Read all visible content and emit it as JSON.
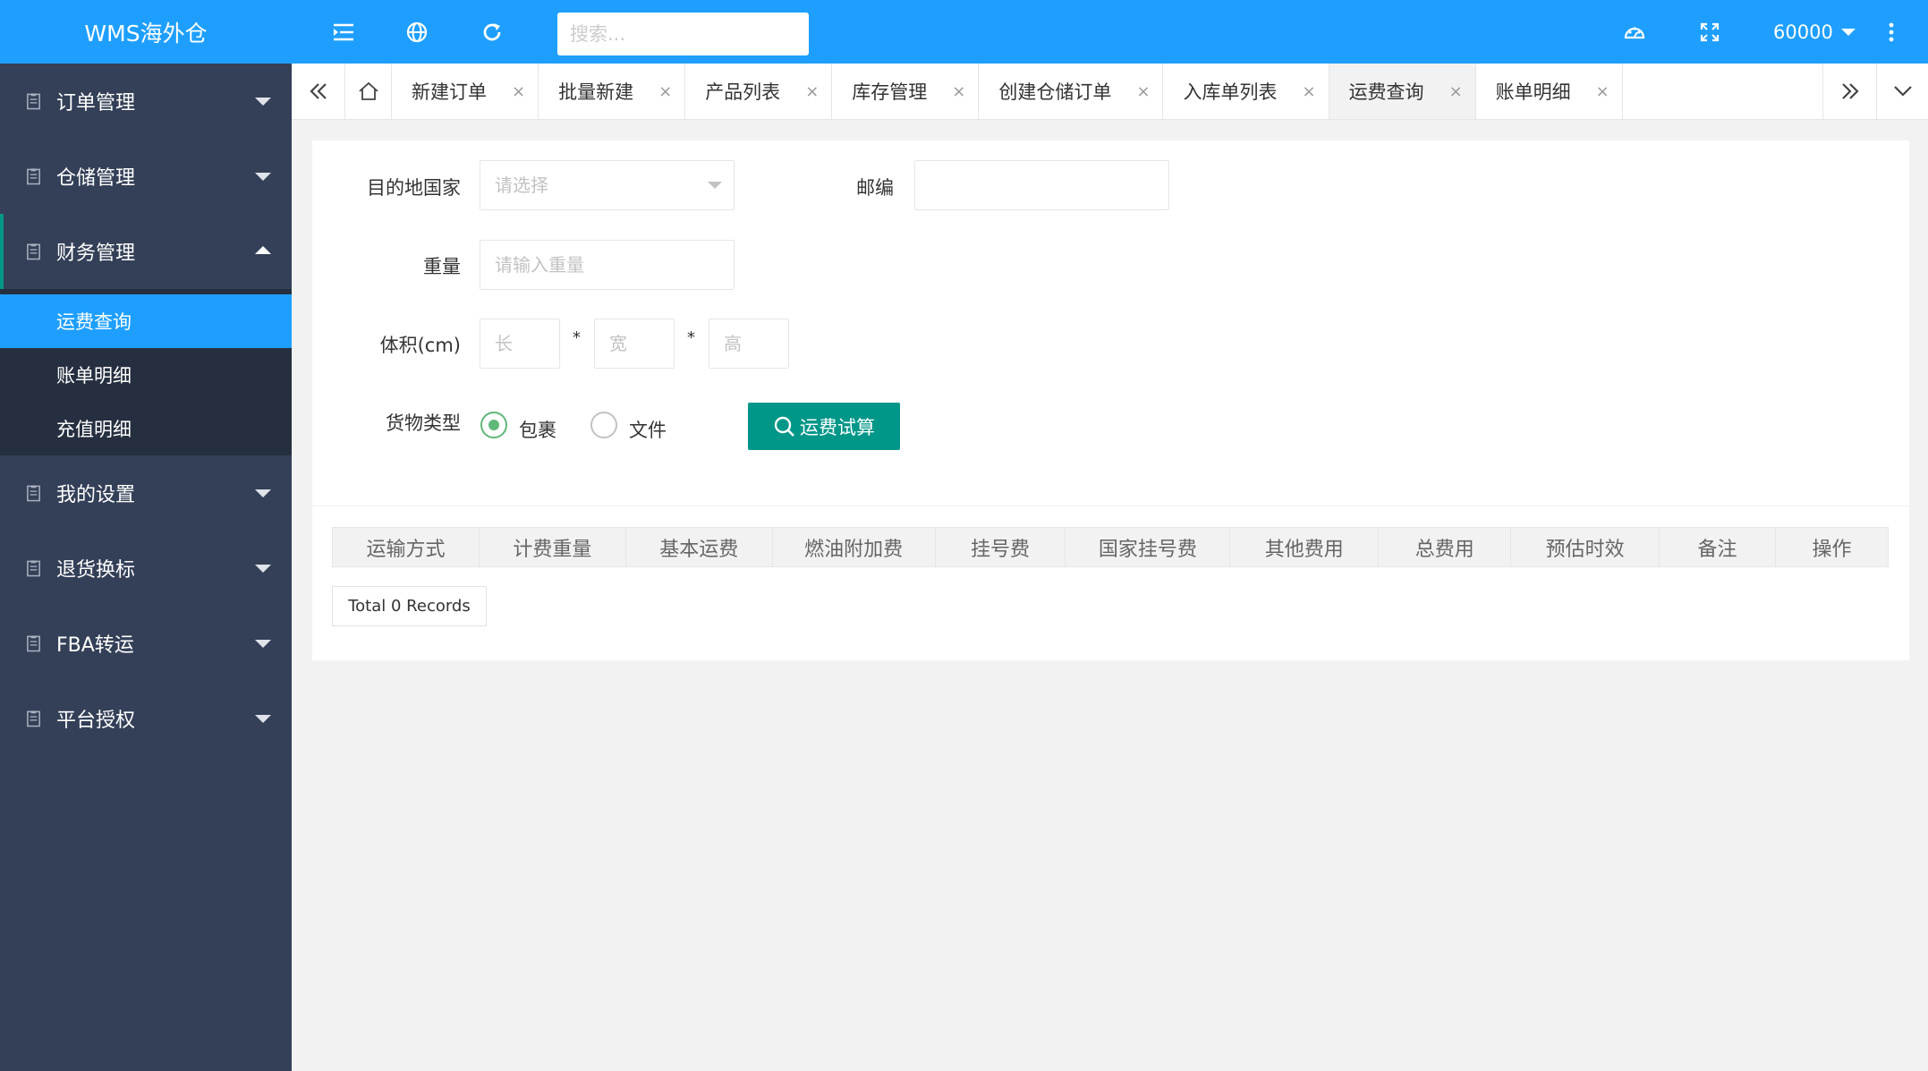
{
  "app": {
    "title": "WMS海外仓"
  },
  "header": {
    "search_placeholder": "搜索...",
    "user": "60000",
    "icons": [
      "menu-fold-icon",
      "globe-icon",
      "refresh-icon",
      "theme-palette-icon",
      "fullscreen-icon",
      "more-vertical-icon"
    ]
  },
  "sidebar": {
    "items": [
      {
        "label": "订单管理"
      },
      {
        "label": "仓储管理"
      },
      {
        "label": "财务管理",
        "expanded": true,
        "children": [
          {
            "label": "运费查询",
            "active": true
          },
          {
            "label": "账单明细"
          },
          {
            "label": "充值明细"
          }
        ]
      },
      {
        "label": "我的设置"
      },
      {
        "label": "退货换标"
      },
      {
        "label": "FBA转运"
      },
      {
        "label": "平台授权"
      }
    ]
  },
  "tabs": [
    {
      "label": "新建订单"
    },
    {
      "label": "批量新建"
    },
    {
      "label": "产品列表"
    },
    {
      "label": "库存管理"
    },
    {
      "label": "创建仓储订单"
    },
    {
      "label": "入库单列表"
    },
    {
      "label": "运费查询",
      "active": true
    },
    {
      "label": "账单明细"
    }
  ],
  "tab_close": "×",
  "form": {
    "country_label": "目的地国家",
    "country_placeholder": "请选择",
    "zip_label": "邮编",
    "zip_value": "",
    "weight_label": "重量",
    "weight_placeholder": "请输入重量",
    "volume_label": "体积(cm)",
    "length_placeholder": "长",
    "width_placeholder": "宽",
    "height_placeholder": "高",
    "multiply": "*",
    "cargo_label": "货物类型",
    "cargo_options": [
      {
        "label": "包裹",
        "checked": true
      },
      {
        "label": "文件",
        "checked": false
      }
    ],
    "calc_button": "运费试算"
  },
  "table": {
    "columns": [
      "运输方式",
      "计费重量",
      "基本运费",
      "燃油附加费",
      "挂号费",
      "国家挂号费",
      "其他费用",
      "总费用",
      "预估时效",
      "备注",
      "操作"
    ]
  },
  "pager": {
    "text": "Total 0 Records"
  },
  "colors": {
    "primary": "#1e9fff",
    "sidebar": "#344058",
    "submenu": "#262f40",
    "accent": "#009688",
    "radio": "#5fb878"
  }
}
